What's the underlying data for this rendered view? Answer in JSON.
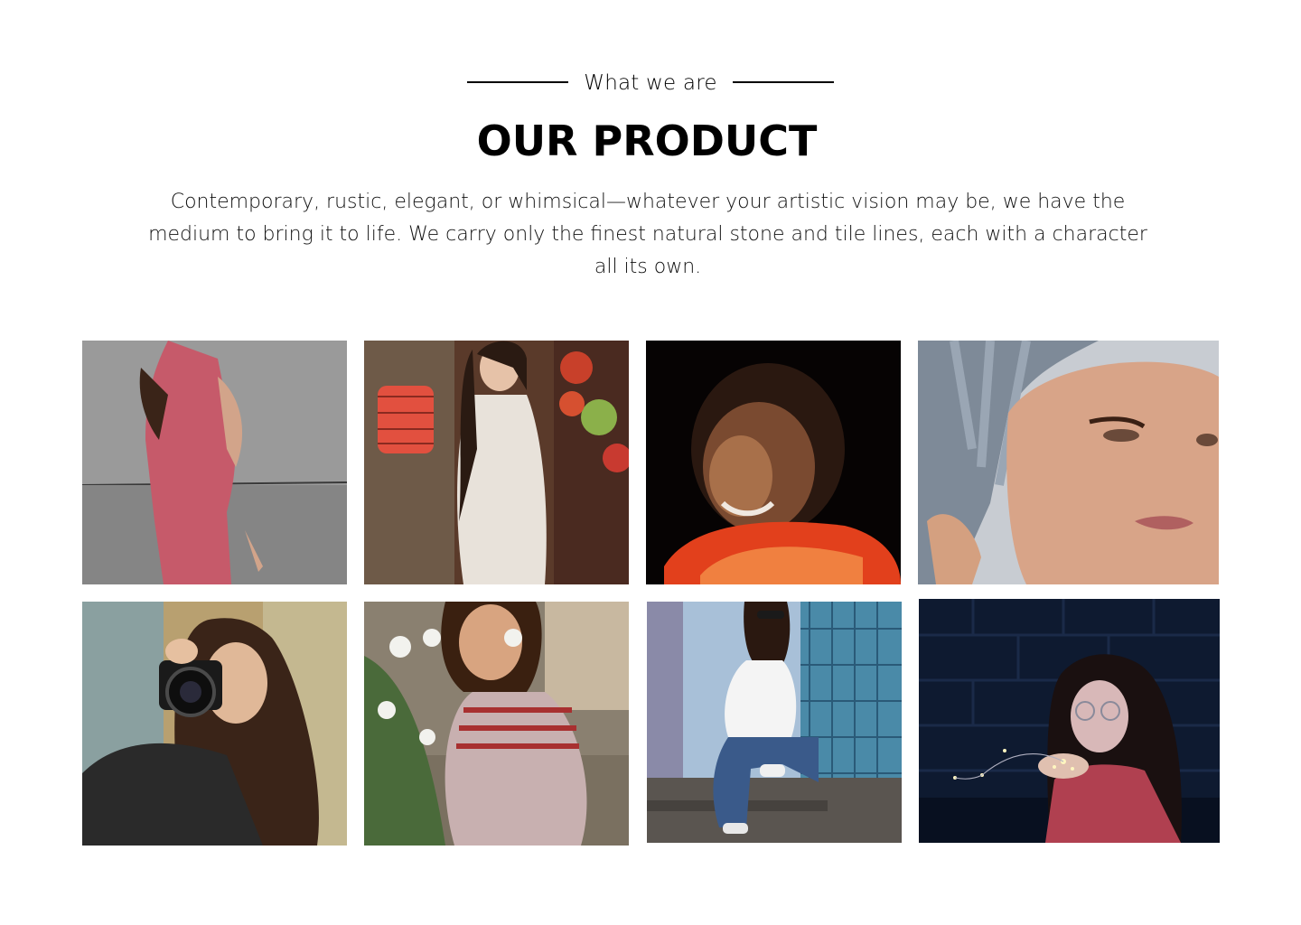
{
  "section": {
    "eyebrow": "What we are",
    "title": "OUR PRODUCT",
    "description": "Contemporary, rustic, elegant, or whimsical—whatever your artistic vision may be, we have the medium to bring it to life. We carry only the finest natural stone and tile lines, each with a character all its own."
  },
  "gallery": {
    "photos": [
      {
        "subject": "woman in pink dress against grey wall"
      },
      {
        "subject": "woman in white dress holding red paper lantern"
      },
      {
        "subject": "smiling woman lit by warm light in darkness"
      },
      {
        "subject": "freckled woman with towel on head"
      },
      {
        "subject": "woman holding camera to her eye"
      },
      {
        "subject": "girl smelling white flowers"
      },
      {
        "subject": "woman in sunglasses sitting on stairs by tiled wall"
      },
      {
        "subject": "woman with glasses holding fairy lights"
      }
    ]
  }
}
